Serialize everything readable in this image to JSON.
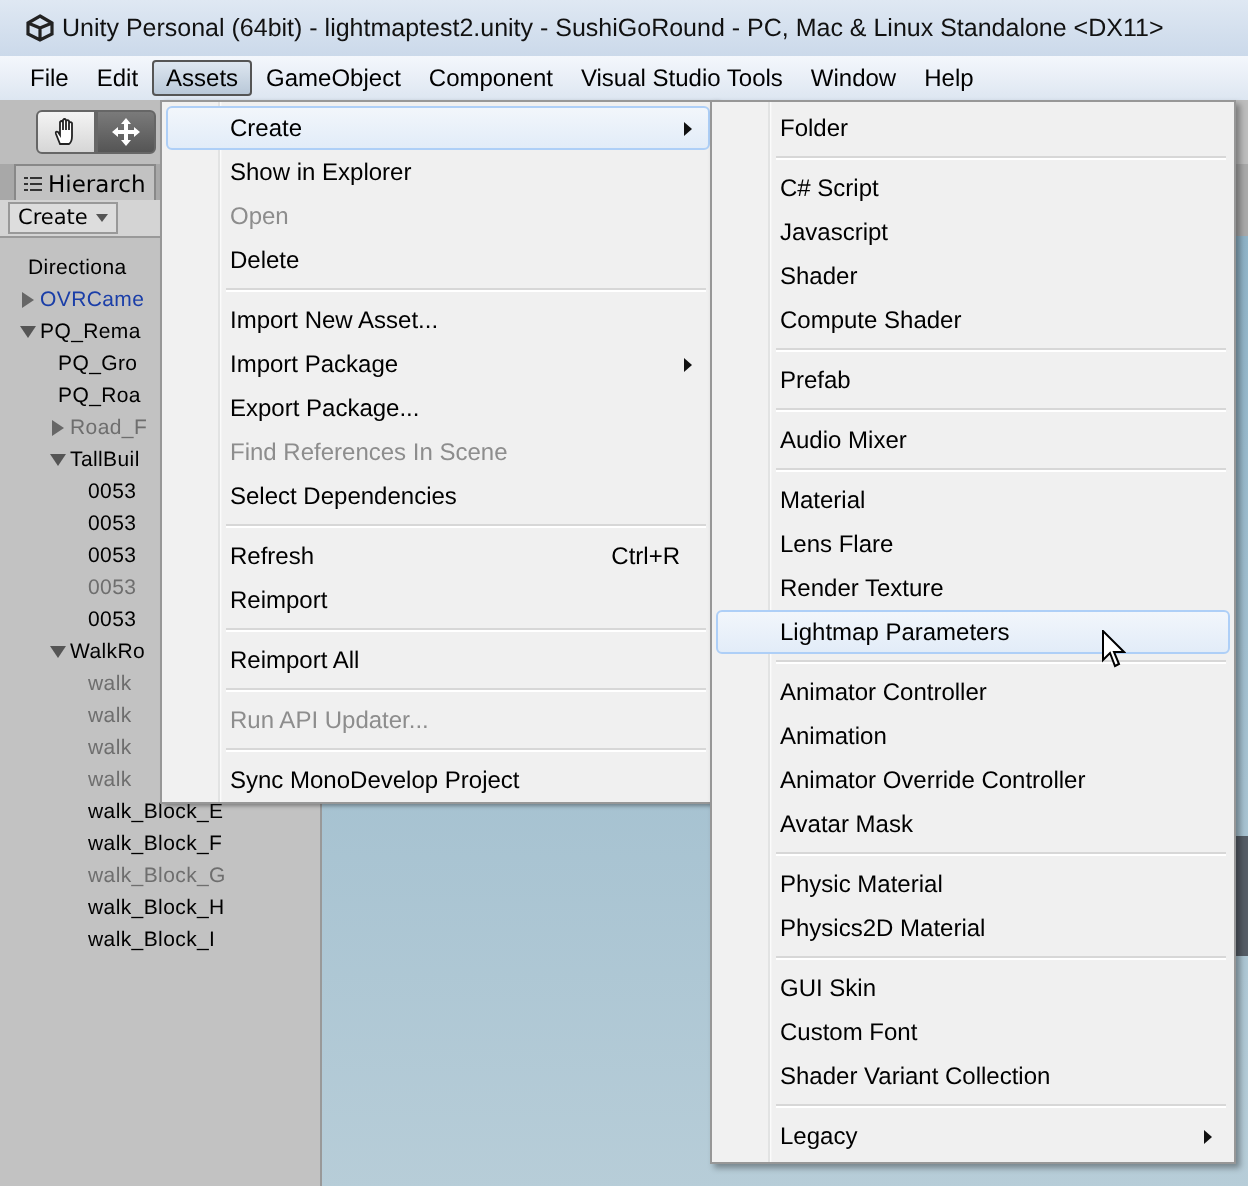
{
  "window": {
    "title": "Unity Personal (64bit) - lightmaptest2.unity - SushiGoRound - PC, Mac & Linux Standalone <DX11>"
  },
  "menubar": [
    {
      "label": "File",
      "selected": false
    },
    {
      "label": "Edit",
      "selected": false
    },
    {
      "label": "Assets",
      "selected": true
    },
    {
      "label": "GameObject",
      "selected": false
    },
    {
      "label": "Component",
      "selected": false
    },
    {
      "label": "Visual Studio Tools",
      "selected": false
    },
    {
      "label": "Window",
      "selected": false
    },
    {
      "label": "Help",
      "selected": false
    }
  ],
  "hierarchy": {
    "tab": "Hierarch",
    "create_button": "Create",
    "items": [
      {
        "label": "Directiona",
        "kind": "object"
      },
      {
        "label": "OVRCame",
        "kind": "prefab",
        "expanded": false
      },
      {
        "label": "PQ_Rema",
        "kind": "object",
        "expanded": true,
        "children": [
          {
            "label": "PQ_Gro",
            "kind": "object"
          },
          {
            "label": "PQ_Roa",
            "kind": "object"
          },
          {
            "label": "Road_F",
            "kind": "inactive",
            "expanded": false
          },
          {
            "label": "TallBuil",
            "kind": "object",
            "expanded": true,
            "children": [
              {
                "label": "0053",
                "kind": "object"
              },
              {
                "label": "0053",
                "kind": "object"
              },
              {
                "label": "0053",
                "kind": "object"
              },
              {
                "label": "0053",
                "kind": "inactive"
              },
              {
                "label": "0053",
                "kind": "object"
              }
            ]
          },
          {
            "label": "WalkRo",
            "kind": "object",
            "expanded": true,
            "children": [
              {
                "label": "walk",
                "kind": "inactive"
              },
              {
                "label": "walk",
                "kind": "inactive"
              },
              {
                "label": "walk",
                "kind": "inactive"
              },
              {
                "label": "walk",
                "kind": "inactive"
              },
              {
                "label": "walk_Block_E",
                "kind": "object"
              },
              {
                "label": "walk_Block_F",
                "kind": "object"
              },
              {
                "label": "walk_Block_G",
                "kind": "inactive"
              },
              {
                "label": "walk_Block_H",
                "kind": "object"
              },
              {
                "label": "walk_Block_I",
                "kind": "object"
              }
            ]
          }
        ]
      }
    ]
  },
  "assets_menu": {
    "groups": [
      [
        {
          "label": "Create",
          "submenu": true,
          "disabled": false,
          "selected": true
        },
        {
          "label": "Show in Explorer",
          "disabled": false,
          "selected": false
        },
        {
          "label": "Open",
          "disabled": true,
          "selected": false
        },
        {
          "label": "Delete",
          "disabled": false,
          "selected": false
        }
      ],
      [
        {
          "label": "Import New Asset...",
          "disabled": false,
          "selected": false
        },
        {
          "label": "Import Package",
          "submenu": true,
          "disabled": false,
          "selected": false
        },
        {
          "label": "Export Package...",
          "disabled": false,
          "selected": false
        },
        {
          "label": "Find References In Scene",
          "disabled": true,
          "selected": false
        },
        {
          "label": "Select Dependencies",
          "disabled": false,
          "selected": false
        }
      ],
      [
        {
          "label": "Refresh",
          "shortcut": "Ctrl+R",
          "disabled": false,
          "selected": false
        },
        {
          "label": "Reimport",
          "disabled": false,
          "selected": false
        }
      ],
      [
        {
          "label": "Reimport All",
          "disabled": false,
          "selected": false
        }
      ],
      [
        {
          "label": "Run API Updater...",
          "disabled": true,
          "selected": false
        }
      ],
      [
        {
          "label": "Sync MonoDevelop Project",
          "disabled": false,
          "selected": false
        }
      ]
    ]
  },
  "create_submenu": {
    "groups": [
      [
        {
          "label": "Folder",
          "selected": false
        }
      ],
      [
        {
          "label": "C# Script",
          "selected": false
        },
        {
          "label": "Javascript",
          "selected": false
        },
        {
          "label": "Shader",
          "selected": false
        },
        {
          "label": "Compute Shader",
          "selected": false
        }
      ],
      [
        {
          "label": "Prefab",
          "selected": false
        }
      ],
      [
        {
          "label": "Audio Mixer",
          "selected": false
        }
      ],
      [
        {
          "label": "Material",
          "selected": false
        },
        {
          "label": "Lens Flare",
          "selected": false
        },
        {
          "label": "Render Texture",
          "selected": false
        },
        {
          "label": "Lightmap Parameters",
          "selected": true
        }
      ],
      [
        {
          "label": "Animator Controller",
          "selected": false
        },
        {
          "label": "Animation",
          "selected": false
        },
        {
          "label": "Animator Override Controller",
          "selected": false
        },
        {
          "label": "Avatar Mask",
          "selected": false
        }
      ],
      [
        {
          "label": "Physic Material",
          "selected": false
        },
        {
          "label": "Physics2D Material",
          "selected": false
        }
      ],
      [
        {
          "label": "GUI Skin",
          "selected": false
        },
        {
          "label": "Custom Font",
          "selected": false
        },
        {
          "label": "Shader Variant Collection",
          "selected": false
        }
      ],
      [
        {
          "label": "Legacy",
          "submenu": true,
          "selected": false
        }
      ]
    ]
  }
}
